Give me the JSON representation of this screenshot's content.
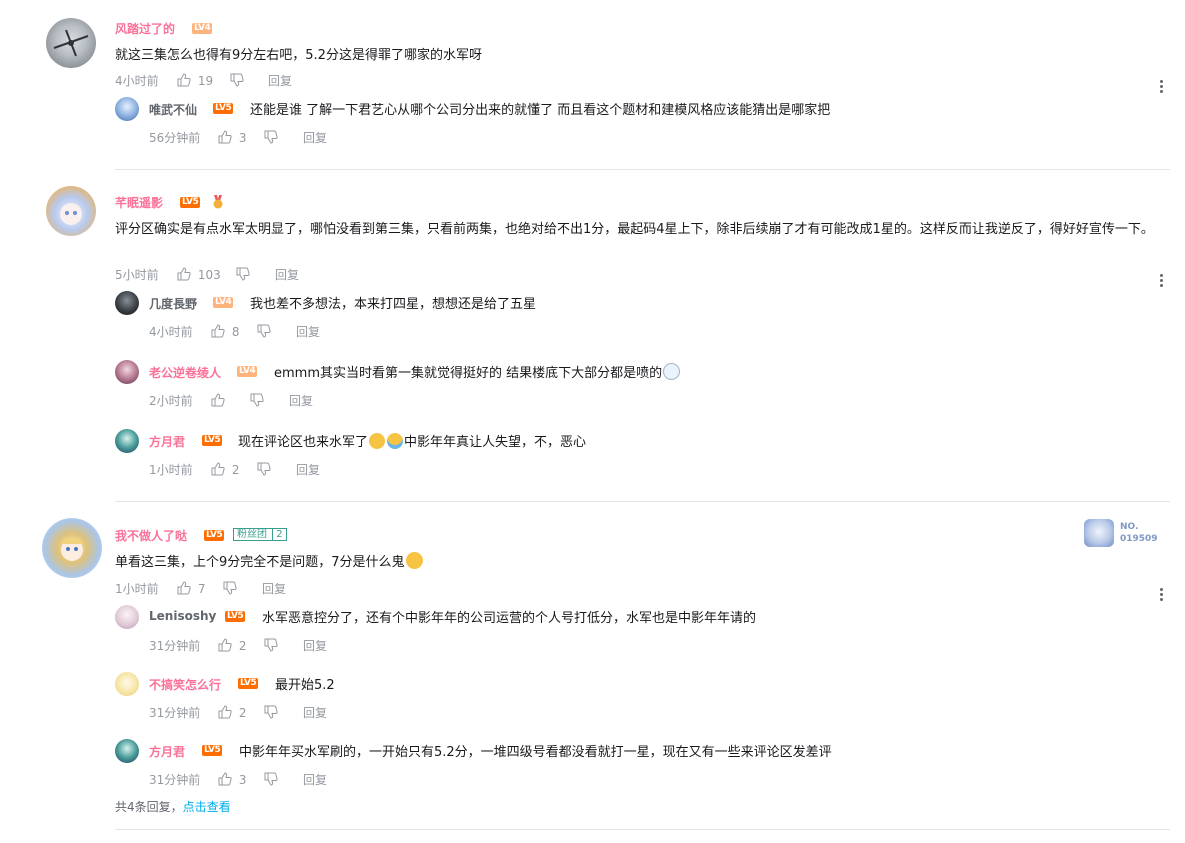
{
  "labels": {
    "reply": "回复"
  },
  "colors": {
    "name_vip": "#fb7299",
    "name_normal": "#61666d",
    "level5": "#ff6c00",
    "level4": "#ffb37c",
    "link": "#00aeec",
    "divider": "#e3e5e7"
  },
  "comments": [
    {
      "user": "风踏过了的",
      "level": "LV4",
      "text": "就这三集怎么也得有9分左右吧，5.2分这是得罪了哪家的水军呀",
      "time": "4小时前",
      "likes": "19",
      "replies": [
        {
          "user": "唯武不仙",
          "level": "LV5",
          "text": "还能是谁 了解一下君艺心从哪个公司分出来的就懂了 而且看这个题材和建模风格应该能猜出是哪家把",
          "time": "56分钟前",
          "likes": "3"
        }
      ]
    },
    {
      "user": "芊眠遥影",
      "level": "LV5",
      "text": "评分区确实是有点水军太明显了，哪怕没看到第三集，只看前两集，也绝对给不出1分，最起码4星上下，除非后续崩了才有可能改成1星的。这样反而让我逆反了，得好好宣传一下。",
      "time": "5小时前",
      "likes": "103",
      "replies": [
        {
          "user": "几度長野",
          "level": "LV4",
          "text": "我也差不多想法，本来打四星，想想还是给了五星",
          "time": "4小时前",
          "likes": "8"
        },
        {
          "user": "老公逆卷绫人",
          "level": "LV4",
          "text": "emmm其实当时看第一集就觉得挺好的 结果楼底下大部分都是喷的",
          "time": "2小时前",
          "likes": ""
        },
        {
          "user": "方月君",
          "level": "LV5",
          "text_a": "现在评论区也来水军了",
          "text_b": "中影年年真让人失望，不，恶心",
          "time": "1小时前",
          "likes": "2"
        }
      ]
    },
    {
      "user": "我不做人了哒",
      "level": "LV5",
      "fan_label": "粉丝团",
      "fan_level": "2",
      "badge_no": "NO.",
      "badge_num": "019509",
      "text": "单看这三集，上个9分完全不是问题，7分是什么鬼",
      "time": "1小时前",
      "likes": "7",
      "replies": [
        {
          "user": "Lenisoshy",
          "level": "LV5",
          "text": "水军恶意控分了，还有个中影年年的公司运营的个人号打低分，水军也是中影年年请的",
          "time": "31分钟前",
          "likes": "2"
        },
        {
          "user": "不搞笑怎么行",
          "level": "LV5",
          "text": "最开始5.2",
          "time": "31分钟前",
          "likes": "2"
        },
        {
          "user": "方月君",
          "level": "LV5",
          "text": "中影年年买水军刷的，一开始只有5.2分，一堆四级号看都没看就打一星，现在又有一些来评论区发差评",
          "time": "31分钟前",
          "likes": "3"
        }
      ],
      "more_prefix": "共4条回复，",
      "more_link": "点击查看"
    }
  ]
}
